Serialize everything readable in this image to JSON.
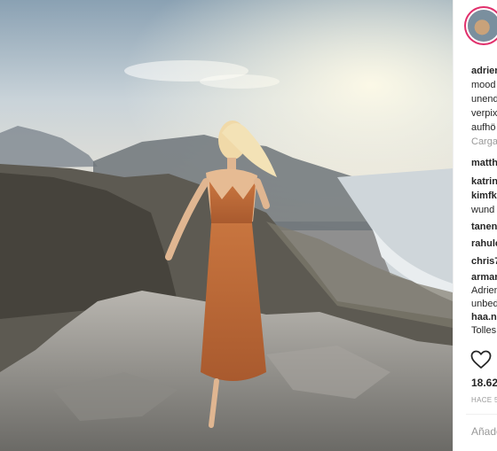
{
  "post": {
    "image_alt": "Woman in a rust-colored maxi dress standing on a rocky summit above mountains and the ocean at sunset"
  },
  "sidebar": {
    "caption": {
      "username": "adrien",
      "lines": [
        "mood",
        "unend",
        "verpix",
        "aufhö"
      ]
    },
    "loading_text": "Carga",
    "comments": [
      {
        "user": "matth",
        "text": ""
      },
      {
        "user": "katrin",
        "text": ""
      },
      {
        "user": "kimfk",
        "text": "wund"
      },
      {
        "user": "tanen",
        "text": ""
      },
      {
        "user": "rahulc",
        "text": ""
      },
      {
        "user": "chris7",
        "text": ""
      },
      {
        "user": "arman",
        "text": "Adrien"
      },
      {
        "user": "",
        "text": "unbed"
      },
      {
        "user": "haa.n",
        "text": "Tolles"
      }
    ],
    "likes_count": "18.62",
    "time_ago": "HACE 5",
    "add_comment_placeholder": "Añade"
  },
  "colors": {
    "accent_ring": "#e1306c",
    "text": "#262626",
    "muted": "#999999"
  }
}
